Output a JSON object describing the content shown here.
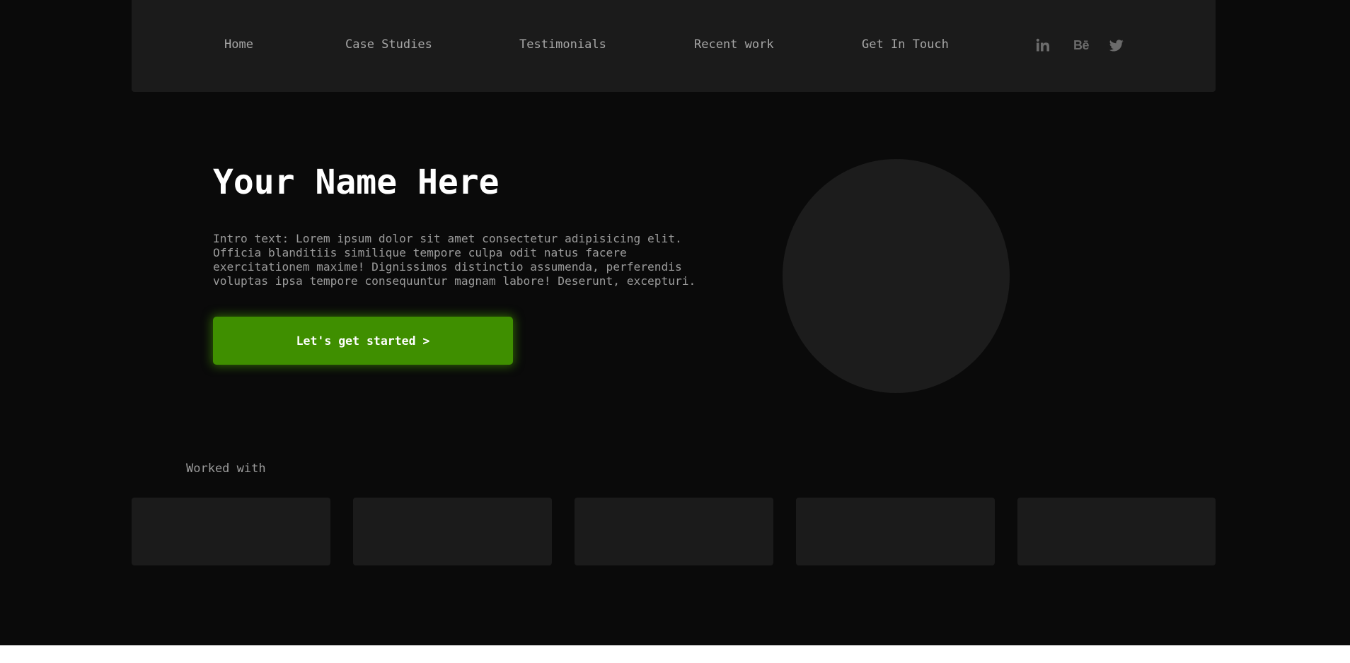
{
  "nav": {
    "links": [
      {
        "label": "Home"
      },
      {
        "label": "Case Studies"
      },
      {
        "label": "Testimonials"
      },
      {
        "label": "Recent work"
      },
      {
        "label": "Get In Touch"
      }
    ],
    "social": {
      "linkedin_icon": "linkedin-icon",
      "behance_icon": "behance-icon",
      "behance_text": "Bē",
      "twitter_icon": "twitter-icon"
    }
  },
  "hero": {
    "title": "Your Name Here",
    "intro": "Intro text: Lorem ipsum dolor sit amet consectetur adipisicing elit. Officia blanditiis similique tempore culpa odit natus facere exercitationem maxime! Dignissimos distinctio assumenda, perferendis voluptas ipsa tempore consequuntur magnam labore! Deserunt, excepturi.",
    "cta_label": "Let's get started >"
  },
  "worked_with": {
    "label": "Worked with"
  },
  "colors": {
    "background": "#0a0a0a",
    "panel": "#1b1b1b",
    "accent": "#3f8f00",
    "text_muted": "#9b9b9b",
    "text_primary": "#ffffff"
  }
}
